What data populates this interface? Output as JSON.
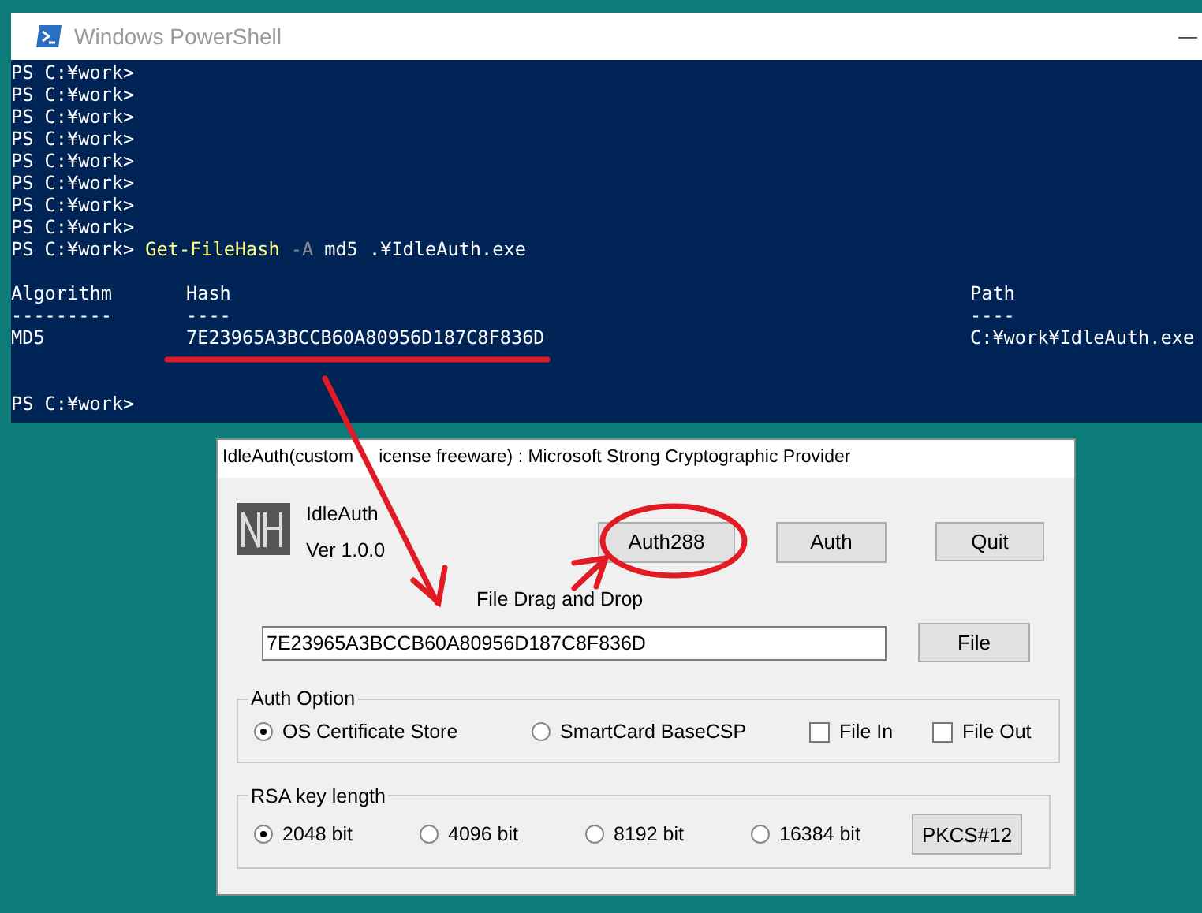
{
  "powershell": {
    "title": "Windows PowerShell",
    "minimize": "—",
    "prompts": [
      "PS C:¥work>",
      "PS C:¥work>",
      "PS C:¥work>",
      "PS C:¥work>",
      "PS C:¥work>",
      "PS C:¥work>",
      "PS C:¥work>",
      "PS C:¥work>"
    ],
    "command": {
      "prompt": "PS C:¥work>",
      "cmdlet": "Get-FileHash",
      "parameter": "-A",
      "arguments": "md5 .¥IdleAuth.exe"
    },
    "table": {
      "columns": [
        {
          "header": "Algorithm",
          "rule": "---------"
        },
        {
          "header": "Hash",
          "rule": "----"
        },
        {
          "header": "Path",
          "rule": "----"
        }
      ],
      "rows": [
        [
          "MD5",
          "7E23965A3BCCB60A80956D187C8F836D",
          "C:¥work¥IdleAuth.exe"
        ]
      ]
    },
    "final_prompt": "PS C:¥work>"
  },
  "dialog": {
    "title_parts": [
      "IdleAuth(custom",
      "icense freeware) : Microsoft Strong Cryptographic Provider"
    ],
    "app_name": "IdleAuth",
    "version": "Ver 1.0.0",
    "buttons": [
      "Auth288",
      "Auth",
      "Quit"
    ],
    "drop_label": "File Drag and Drop",
    "hash_field": {
      "value": "7E23965A3BCCB60A80956D187C8F836D"
    },
    "file_button": "File",
    "auth_option": {
      "legend": "Auth Option",
      "items": [
        {
          "kind": "radio",
          "label": "OS Certificate Store",
          "selected": true
        },
        {
          "kind": "radio",
          "label": "SmartCard BaseCSP",
          "selected": false
        },
        {
          "kind": "checkbox",
          "label": "File In",
          "checked": false
        },
        {
          "kind": "checkbox",
          "label": "File Out",
          "checked": false
        }
      ]
    },
    "rsa": {
      "legend": "RSA key length",
      "items": [
        {
          "label": "2048 bit",
          "selected": true
        },
        {
          "label": "4096 bit",
          "selected": false
        },
        {
          "label": "8192 bit",
          "selected": false
        },
        {
          "label": "16384 bit",
          "selected": false
        }
      ],
      "button": "PKCS#12"
    }
  }
}
